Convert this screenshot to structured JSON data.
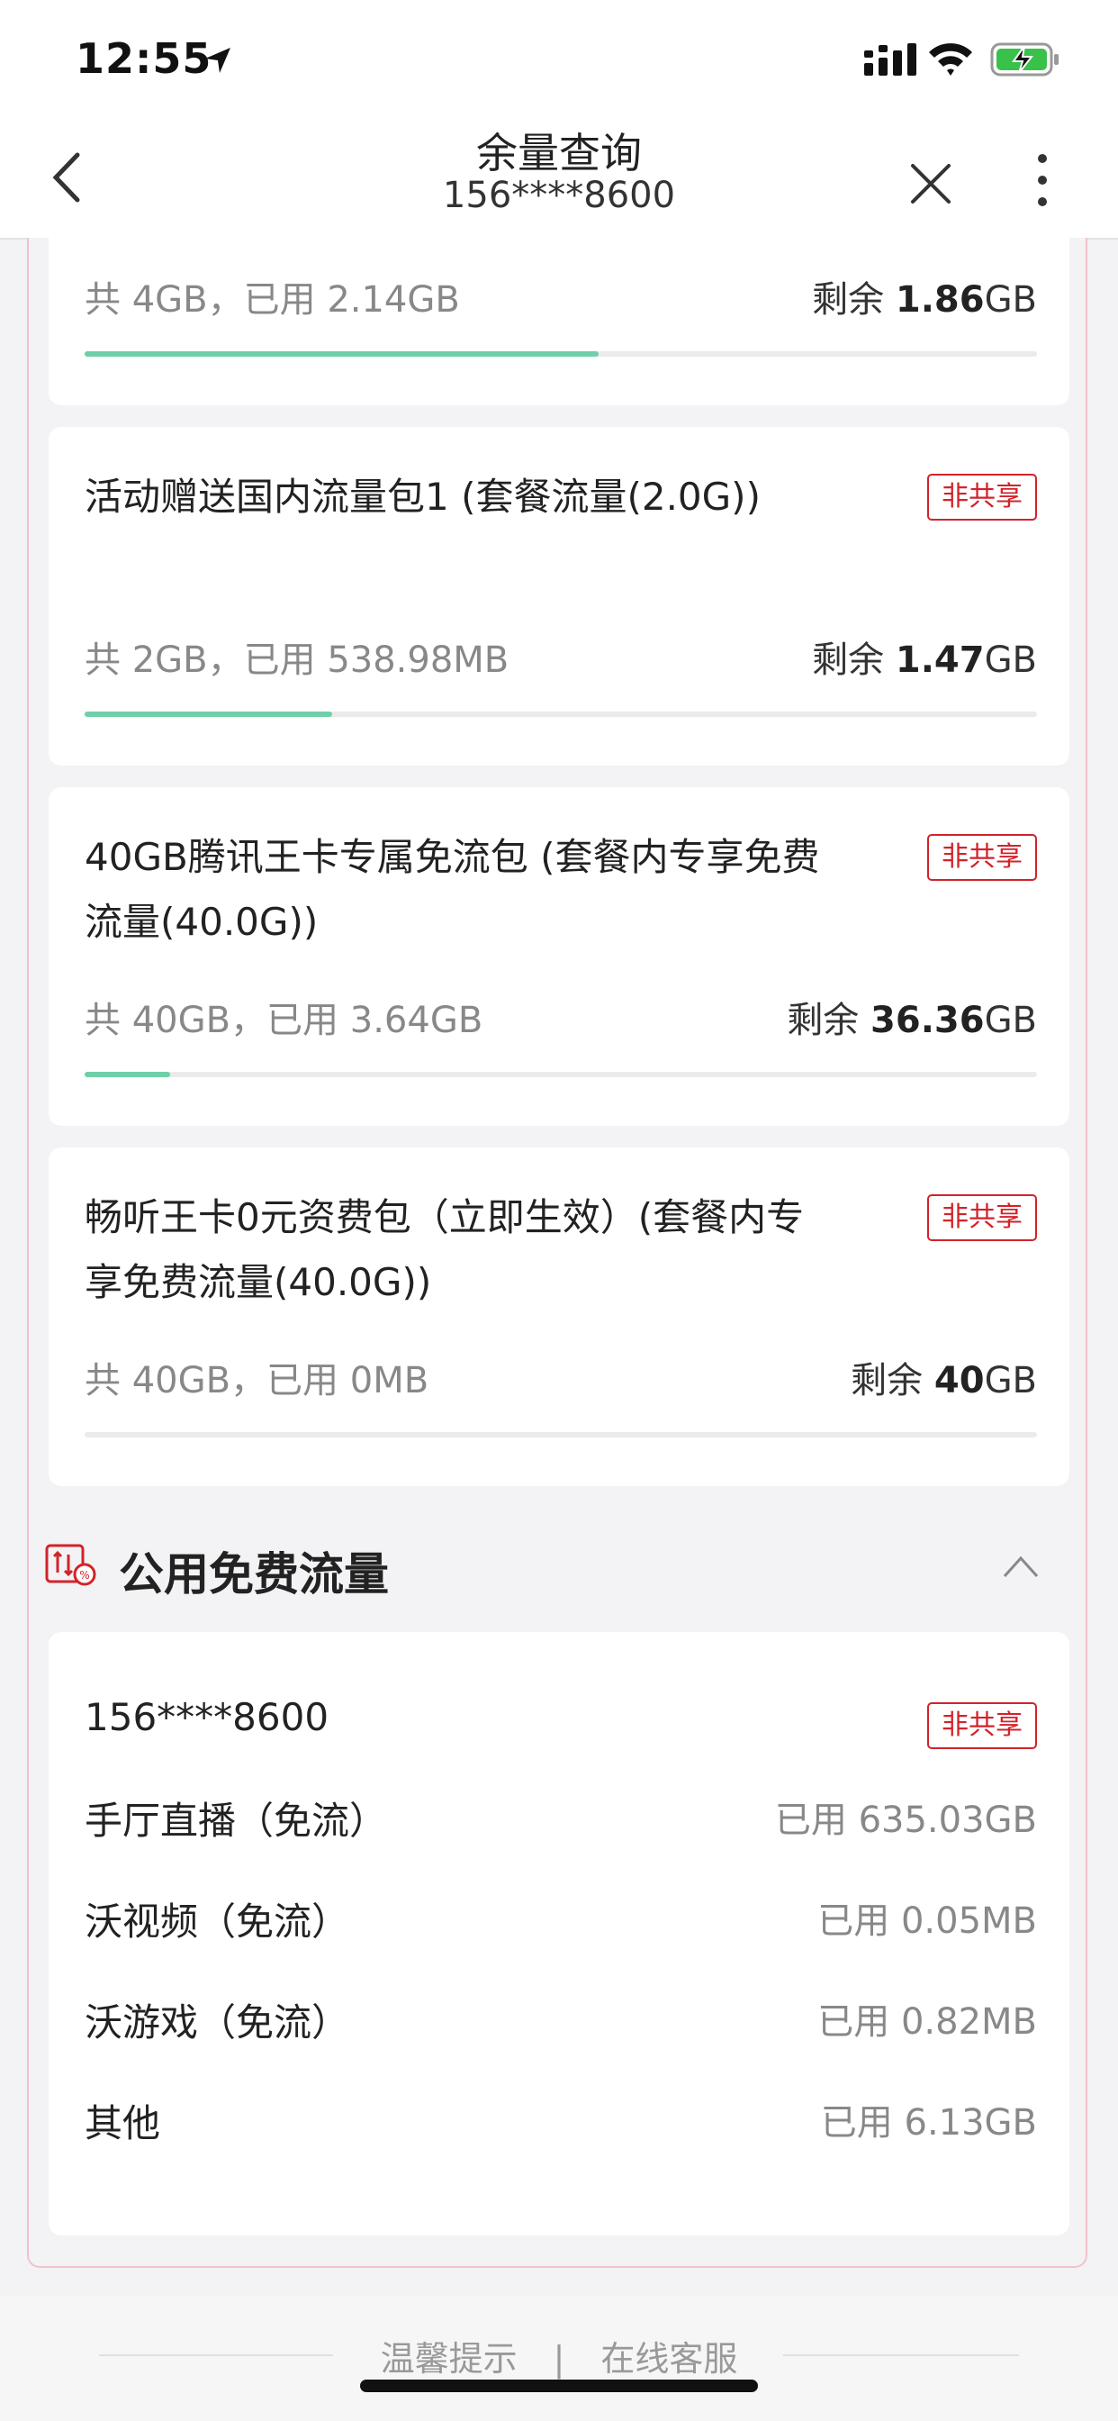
{
  "status": {
    "time": "12:55"
  },
  "nav": {
    "title": "余量查询",
    "subtitle": "156****8600"
  },
  "cards": [
    {
      "used": "共 4GB，已用 2.14GB",
      "remain_label": "剩余 ",
      "remain_value": "1.86",
      "remain_unit": "GB",
      "progress": 0.54
    },
    {
      "title": "活动赠送国内流量包1 (套餐流量(2.0G))",
      "badge": "非共享",
      "used": "共 2GB，已用 538.98MB",
      "remain_label": "剩余 ",
      "remain_value": "1.47",
      "remain_unit": "GB",
      "progress": 0.26
    },
    {
      "title": "40GB腾讯王卡专属免流包 (套餐内专享免费流量(40.0G))",
      "badge": "非共享",
      "used": "共 40GB，已用 3.64GB",
      "remain_label": "剩余 ",
      "remain_value": "36.36",
      "remain_unit": "GB",
      "progress": 0.09
    },
    {
      "title": "畅听王卡0元资费包（立即生效）(套餐内专享免费流量(40.0G))",
      "badge": "非共享",
      "used": "共 40GB，已用 0MB",
      "remain_label": "剩余 ",
      "remain_value": "40",
      "remain_unit": "GB",
      "progress": 0.0
    }
  ],
  "section": {
    "title": "公用免费流量"
  },
  "free": {
    "number": "156****8600",
    "badge": "非共享",
    "rows": [
      {
        "label": "手厅直播（免流）",
        "value": "已用 635.03GB"
      },
      {
        "label": "沃视频（免流）",
        "value": "已用 0.05MB"
      },
      {
        "label": "沃游戏（免流）",
        "value": "已用 0.82MB"
      },
      {
        "label": "其他",
        "value": "已用 6.13GB"
      }
    ]
  },
  "footer": {
    "tip": "温馨提示",
    "sep": "|",
    "service": "在线客服"
  },
  "colors": {
    "progress": "#6fcfa8",
    "badge": "#d2232a",
    "border": "#f1c2cc"
  }
}
